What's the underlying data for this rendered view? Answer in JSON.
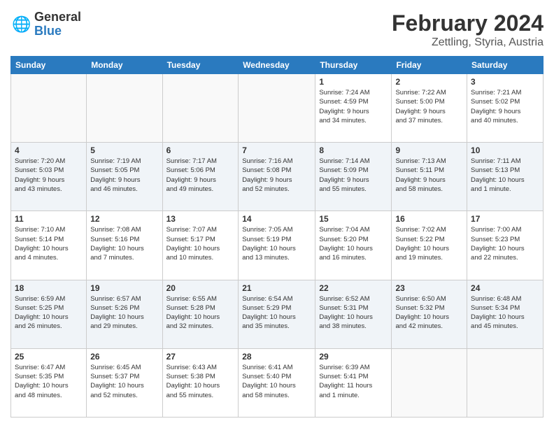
{
  "logo": {
    "general": "General",
    "blue": "Blue"
  },
  "title": {
    "month_year": "February 2024",
    "location": "Zettling, Styria, Austria"
  },
  "weekdays": [
    "Sunday",
    "Monday",
    "Tuesday",
    "Wednesday",
    "Thursday",
    "Friday",
    "Saturday"
  ],
  "weeks": [
    [
      {
        "day": "",
        "info": ""
      },
      {
        "day": "",
        "info": ""
      },
      {
        "day": "",
        "info": ""
      },
      {
        "day": "",
        "info": ""
      },
      {
        "day": "1",
        "info": "Sunrise: 7:24 AM\nSunset: 4:59 PM\nDaylight: 9 hours\nand 34 minutes."
      },
      {
        "day": "2",
        "info": "Sunrise: 7:22 AM\nSunset: 5:00 PM\nDaylight: 9 hours\nand 37 minutes."
      },
      {
        "day": "3",
        "info": "Sunrise: 7:21 AM\nSunset: 5:02 PM\nDaylight: 9 hours\nand 40 minutes."
      }
    ],
    [
      {
        "day": "4",
        "info": "Sunrise: 7:20 AM\nSunset: 5:03 PM\nDaylight: 9 hours\nand 43 minutes."
      },
      {
        "day": "5",
        "info": "Sunrise: 7:19 AM\nSunset: 5:05 PM\nDaylight: 9 hours\nand 46 minutes."
      },
      {
        "day": "6",
        "info": "Sunrise: 7:17 AM\nSunset: 5:06 PM\nDaylight: 9 hours\nand 49 minutes."
      },
      {
        "day": "7",
        "info": "Sunrise: 7:16 AM\nSunset: 5:08 PM\nDaylight: 9 hours\nand 52 minutes."
      },
      {
        "day": "8",
        "info": "Sunrise: 7:14 AM\nSunset: 5:09 PM\nDaylight: 9 hours\nand 55 minutes."
      },
      {
        "day": "9",
        "info": "Sunrise: 7:13 AM\nSunset: 5:11 PM\nDaylight: 9 hours\nand 58 minutes."
      },
      {
        "day": "10",
        "info": "Sunrise: 7:11 AM\nSunset: 5:13 PM\nDaylight: 10 hours\nand 1 minute."
      }
    ],
    [
      {
        "day": "11",
        "info": "Sunrise: 7:10 AM\nSunset: 5:14 PM\nDaylight: 10 hours\nand 4 minutes."
      },
      {
        "day": "12",
        "info": "Sunrise: 7:08 AM\nSunset: 5:16 PM\nDaylight: 10 hours\nand 7 minutes."
      },
      {
        "day": "13",
        "info": "Sunrise: 7:07 AM\nSunset: 5:17 PM\nDaylight: 10 hours\nand 10 minutes."
      },
      {
        "day": "14",
        "info": "Sunrise: 7:05 AM\nSunset: 5:19 PM\nDaylight: 10 hours\nand 13 minutes."
      },
      {
        "day": "15",
        "info": "Sunrise: 7:04 AM\nSunset: 5:20 PM\nDaylight: 10 hours\nand 16 minutes."
      },
      {
        "day": "16",
        "info": "Sunrise: 7:02 AM\nSunset: 5:22 PM\nDaylight: 10 hours\nand 19 minutes."
      },
      {
        "day": "17",
        "info": "Sunrise: 7:00 AM\nSunset: 5:23 PM\nDaylight: 10 hours\nand 22 minutes."
      }
    ],
    [
      {
        "day": "18",
        "info": "Sunrise: 6:59 AM\nSunset: 5:25 PM\nDaylight: 10 hours\nand 26 minutes."
      },
      {
        "day": "19",
        "info": "Sunrise: 6:57 AM\nSunset: 5:26 PM\nDaylight: 10 hours\nand 29 minutes."
      },
      {
        "day": "20",
        "info": "Sunrise: 6:55 AM\nSunset: 5:28 PM\nDaylight: 10 hours\nand 32 minutes."
      },
      {
        "day": "21",
        "info": "Sunrise: 6:54 AM\nSunset: 5:29 PM\nDaylight: 10 hours\nand 35 minutes."
      },
      {
        "day": "22",
        "info": "Sunrise: 6:52 AM\nSunset: 5:31 PM\nDaylight: 10 hours\nand 38 minutes."
      },
      {
        "day": "23",
        "info": "Sunrise: 6:50 AM\nSunset: 5:32 PM\nDaylight: 10 hours\nand 42 minutes."
      },
      {
        "day": "24",
        "info": "Sunrise: 6:48 AM\nSunset: 5:34 PM\nDaylight: 10 hours\nand 45 minutes."
      }
    ],
    [
      {
        "day": "25",
        "info": "Sunrise: 6:47 AM\nSunset: 5:35 PM\nDaylight: 10 hours\nand 48 minutes."
      },
      {
        "day": "26",
        "info": "Sunrise: 6:45 AM\nSunset: 5:37 PM\nDaylight: 10 hours\nand 52 minutes."
      },
      {
        "day": "27",
        "info": "Sunrise: 6:43 AM\nSunset: 5:38 PM\nDaylight: 10 hours\nand 55 minutes."
      },
      {
        "day": "28",
        "info": "Sunrise: 6:41 AM\nSunset: 5:40 PM\nDaylight: 10 hours\nand 58 minutes."
      },
      {
        "day": "29",
        "info": "Sunrise: 6:39 AM\nSunset: 5:41 PM\nDaylight: 11 hours\nand 1 minute."
      },
      {
        "day": "",
        "info": ""
      },
      {
        "day": "",
        "info": ""
      }
    ]
  ]
}
